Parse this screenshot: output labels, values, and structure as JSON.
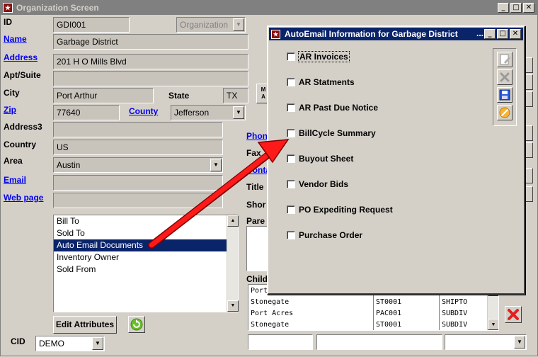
{
  "main_window": {
    "title": "Organization Screen",
    "labels": {
      "id": "ID",
      "name": "Name",
      "address": "Address",
      "apt": "Apt/Suite",
      "city": "City",
      "state": "State",
      "zip": "Zip",
      "county": "County",
      "address3": "Address3",
      "country": "Country",
      "area": "Area",
      "email": "Email",
      "webpage": "Web page",
      "cid": "CID",
      "phone": "Phon",
      "fax": "Fax",
      "contact": "Conta",
      "title": "Title",
      "short": "Shor",
      "parent": "Pare",
      "children": "Child",
      "mid_btn": "M\nA"
    },
    "fields": {
      "id": "GDI001",
      "org_type": "Organization",
      "name": "Garbage District",
      "address": "201 H O Mills Blvd",
      "apt": "",
      "city": "Port Arthur",
      "state": "TX",
      "zip": "77640",
      "county": "Jefferson",
      "address3": "",
      "country": "US",
      "area": "Austin",
      "email": "",
      "webpage": "",
      "cid": "DEMO"
    },
    "list_items": [
      "Bill To",
      "Sold To",
      "Auto Email Documents",
      "Inventory Owner",
      "Sold From"
    ],
    "selected_item": "Auto Email Documents",
    "edit_attributes_label": "Edit Attributes",
    "children_rows": [
      {
        "name": "Port",
        "code": "",
        "type": ""
      },
      {
        "name": "Stonegate",
        "code": "ST0001",
        "type": "SHIPTO"
      },
      {
        "name": "Port Acres",
        "code": "PAC001",
        "type": "SUBDIV"
      },
      {
        "name": "Stonegate",
        "code": "ST0001",
        "type": "SUBDIV"
      }
    ]
  },
  "modal": {
    "title": "AutoEmail Information for Garbage District",
    "title_overflow": "...",
    "options": [
      {
        "label": "AR Invoices",
        "checked": false
      },
      {
        "label": "AR Statments",
        "checked": false
      },
      {
        "label": "AR Past Due Notice",
        "checked": false
      },
      {
        "label": "BillCycle Summary",
        "checked": false
      },
      {
        "label": "Buyout Sheet",
        "checked": false
      },
      {
        "label": "Vendor Bids",
        "checked": false
      },
      {
        "label": "PO Expediting Request",
        "checked": false
      },
      {
        "label": "Purchase Order",
        "checked": false
      }
    ],
    "tools": [
      "edit-icon",
      "delete-icon",
      "save-icon",
      "cancel-icon"
    ]
  },
  "colors": {
    "annotation_arrow": "#ff1a1a",
    "selection": "#0a246a",
    "link": "#0000ee"
  }
}
